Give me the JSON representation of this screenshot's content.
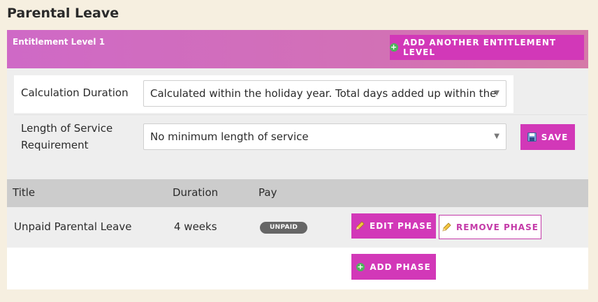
{
  "page": {
    "title": "Parental Leave"
  },
  "header": {
    "level_label": "Entitlement Level 1",
    "add_level_label": "ADD ANOTHER ENTITLEMENT LEVEL"
  },
  "settings": {
    "calc_label": "Calculation Duration",
    "calc_value": "Calculated within the holiday year. Total days added up within the",
    "service_label_line1": "Length of Service",
    "service_label_line2": "Requirement",
    "service_value": "No minimum length of service",
    "save_label": "SAVE"
  },
  "table": {
    "headers": {
      "title": "Title",
      "duration": "Duration",
      "pay": "Pay"
    },
    "rows": [
      {
        "title": "Unpaid Parental Leave",
        "duration": "4 weeks",
        "pay": "UNPAID",
        "edit_label": "EDIT PHASE",
        "remove_label": "REMOVE PHASE"
      }
    ],
    "add_phase_label": "ADD PHASE"
  },
  "colors": {
    "accent": "#d238b8",
    "header_gradient_start": "#cf69c6",
    "header_gradient_end": "#d579a8",
    "page_background": "#f6efe0",
    "badge": "#666666",
    "plus_icon": "#4fb35c"
  },
  "icons": {
    "add_level": "plus-circle-icon",
    "save": "floppy-disk-icon",
    "edit": "pencil-icon",
    "remove": "pencil-icon",
    "add_phase": "plus-circle-icon",
    "select_arrow": "chevron-down-icon"
  }
}
